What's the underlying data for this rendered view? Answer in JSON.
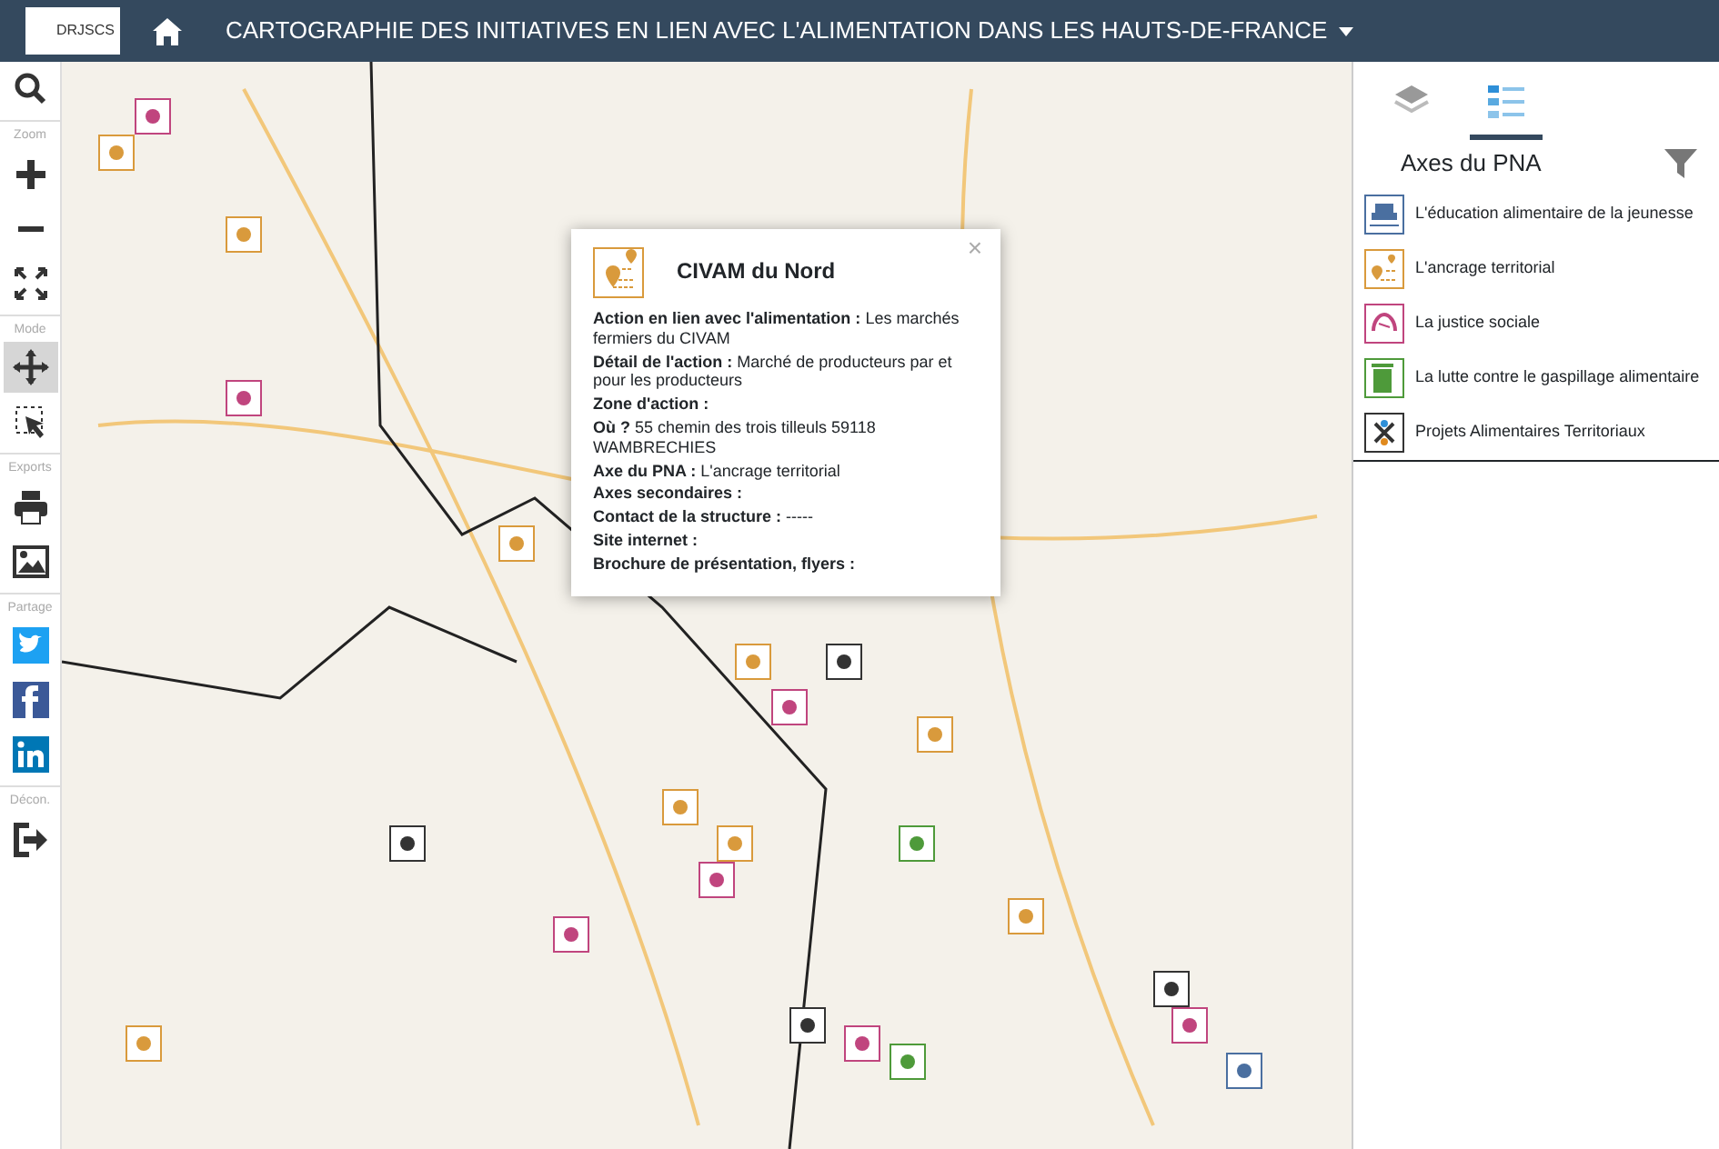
{
  "header": {
    "logo_text": "DRJSCS",
    "title": "CARTOGRAPHIE DES INITIATIVES EN LIEN AVEC L'ALIMENTATION DANS LES HAUTS-DE-FRANCE"
  },
  "toolbar": [
    {
      "kind": "search",
      "selected": false
    },
    {
      "kind": "section",
      "label": "Zoom"
    },
    {
      "kind": "zoom-in",
      "selected": false
    },
    {
      "kind": "zoom-out",
      "selected": false
    },
    {
      "kind": "fullscreen",
      "selected": false
    },
    {
      "kind": "section",
      "label": "Mode"
    },
    {
      "kind": "pan",
      "selected": true
    },
    {
      "kind": "select",
      "selected": false
    },
    {
      "kind": "section",
      "label": "Exports"
    },
    {
      "kind": "print",
      "selected": false
    },
    {
      "kind": "export-image",
      "selected": false
    },
    {
      "kind": "section",
      "label": "Partage"
    },
    {
      "kind": "twitter",
      "selected": false
    },
    {
      "kind": "facebook",
      "selected": false
    },
    {
      "kind": "linkedin",
      "selected": false
    },
    {
      "kind": "section",
      "label": "Décon."
    },
    {
      "kind": "logout",
      "selected": false
    }
  ],
  "popup": {
    "title": "CIVAM du Nord",
    "close": "×",
    "fields": [
      {
        "label": "Action en lien avec l'alimentation :",
        "value": "Les marchés fermiers du CIVAM"
      },
      {
        "label": "Détail de l'action :",
        "value": "Marché de producteurs par et pour les producteurs"
      },
      {
        "label": "Zone d'action :"
      },
      {
        "label": "Où ?",
        "value": "55 chemin des trois tilleuls 59118 WAMBRECHIES"
      },
      {
        "label": "Axe du PNA :",
        "value": "L'ancrage territorial"
      },
      {
        "label": "Axes secondaires :"
      },
      {
        "label": "Contact de la structure :",
        "value": "-----"
      },
      {
        "label": "Site internet :"
      },
      {
        "label": "Brochure de présentation, flyers :"
      }
    ]
  },
  "panel": {
    "tabs": [
      {
        "kind": "layers",
        "selected": false
      },
      {
        "kind": "legend",
        "selected": true
      }
    ],
    "heading": "Axes du PNA",
    "legend": [
      {
        "label": "L'éducation alimentaire de la jeunesse",
        "kind": "education",
        "color": "#4a6fa0"
      },
      {
        "label": "L'ancrage territorial",
        "kind": "ancrage",
        "color": "#d99a3c"
      },
      {
        "label": "La justice sociale",
        "kind": "justice",
        "color": "#c0457e"
      },
      {
        "label": "La lutte contre le gaspillage alimentaire",
        "kind": "gaspillage",
        "color": "#4e9a3a"
      },
      {
        "label": "Projets Alimentaires Territoriaux",
        "kind": "pat",
        "color": "#333333"
      }
    ]
  }
}
